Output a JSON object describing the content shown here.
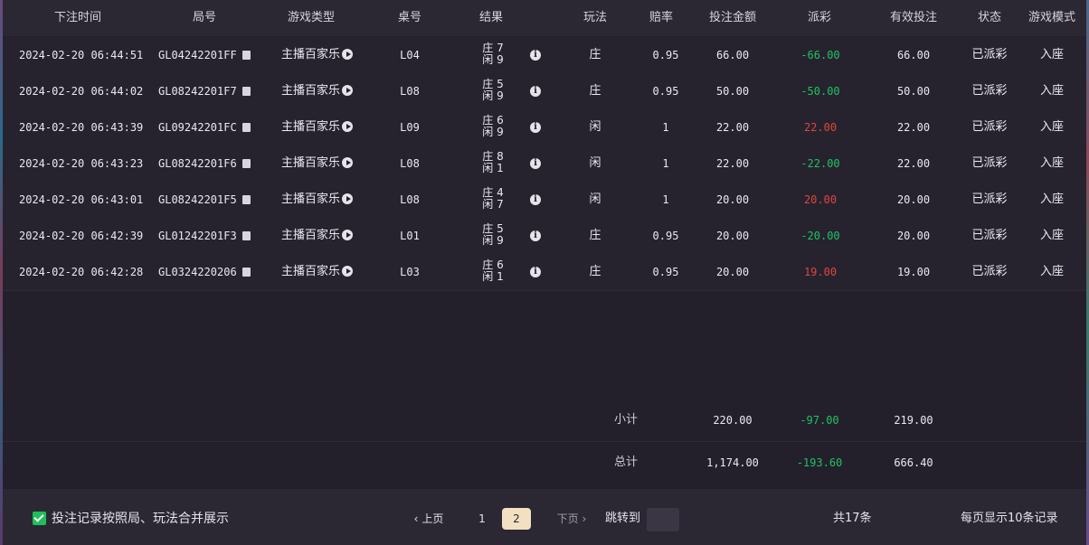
{
  "colors": {
    "positive": "#e0453a",
    "negative": "#1fc25f",
    "active_page_bg": "#f3e0c2",
    "checkbox": "#1fbf5a"
  },
  "headers": [
    "下注时间",
    "局号",
    "游戏类型",
    "桌号",
    "结果",
    "玩法",
    "赔率",
    "投注金额",
    "派彩",
    "有效投注",
    "状态",
    "游戏模式"
  ],
  "rows": [
    {
      "time": "2024-02-20 06:44:51",
      "round": "GL04242201FF",
      "game": "主播百家乐",
      "table": "L04",
      "banker": "庄 7",
      "player": "闲 9",
      "bet": "庄",
      "odds": "0.95",
      "amount": "66.00",
      "payout": "-66.00",
      "payout_sign": "neg",
      "valid": "66.00",
      "status": "已派彩",
      "mode": "入座"
    },
    {
      "time": "2024-02-20 06:44:02",
      "round": "GL08242201F7",
      "game": "主播百家乐",
      "table": "L08",
      "banker": "庄 5",
      "player": "闲 9",
      "bet": "庄",
      "odds": "0.95",
      "amount": "50.00",
      "payout": "-50.00",
      "payout_sign": "neg",
      "valid": "50.00",
      "status": "已派彩",
      "mode": "入座"
    },
    {
      "time": "2024-02-20 06:43:39",
      "round": "GL09242201FC",
      "game": "主播百家乐",
      "table": "L09",
      "banker": "庄 6",
      "player": "闲 9",
      "bet": "闲",
      "odds": "1",
      "amount": "22.00",
      "payout": "22.00",
      "payout_sign": "pos",
      "valid": "22.00",
      "status": "已派彩",
      "mode": "入座"
    },
    {
      "time": "2024-02-20 06:43:23",
      "round": "GL08242201F6",
      "game": "主播百家乐",
      "table": "L08",
      "banker": "庄 8",
      "player": "闲 1",
      "bet": "闲",
      "odds": "1",
      "amount": "22.00",
      "payout": "-22.00",
      "payout_sign": "neg",
      "valid": "22.00",
      "status": "已派彩",
      "mode": "入座"
    },
    {
      "time": "2024-02-20 06:43:01",
      "round": "GL08242201F5",
      "game": "主播百家乐",
      "table": "L08",
      "banker": "庄 4",
      "player": "闲 7",
      "bet": "闲",
      "odds": "1",
      "amount": "20.00",
      "payout": "20.00",
      "payout_sign": "pos",
      "valid": "20.00",
      "status": "已派彩",
      "mode": "入座"
    },
    {
      "time": "2024-02-20 06:42:39",
      "round": "GL01242201F3",
      "game": "主播百家乐",
      "table": "L01",
      "banker": "庄 5",
      "player": "闲 9",
      "bet": "庄",
      "odds": "0.95",
      "amount": "20.00",
      "payout": "-20.00",
      "payout_sign": "neg",
      "valid": "20.00",
      "status": "已派彩",
      "mode": "入座"
    },
    {
      "time": "2024-02-20 06:42:28",
      "round": "GL0324220206",
      "game": "主播百家乐",
      "table": "L03",
      "banker": "庄 6",
      "player": "闲 1",
      "bet": "庄",
      "odds": "0.95",
      "amount": "20.00",
      "payout": "19.00",
      "payout_sign": "pos",
      "valid": "19.00",
      "status": "已派彩",
      "mode": "入座"
    }
  ],
  "subtotal": {
    "label": "小计",
    "amount": "220.00",
    "payout": "-97.00",
    "valid": "219.00"
  },
  "total": {
    "label": "总计",
    "amount": "1,174.00",
    "payout": "-193.60",
    "valid": "666.40"
  },
  "footer": {
    "merge_label": "投注记录按照局、玩法合并展示",
    "prev": "上页",
    "pages": [
      "1",
      "2"
    ],
    "active_page": "2",
    "next": "下页",
    "jump_label": "跳转到",
    "total_count": "共17条",
    "per_page": "每页显示10条记录"
  }
}
